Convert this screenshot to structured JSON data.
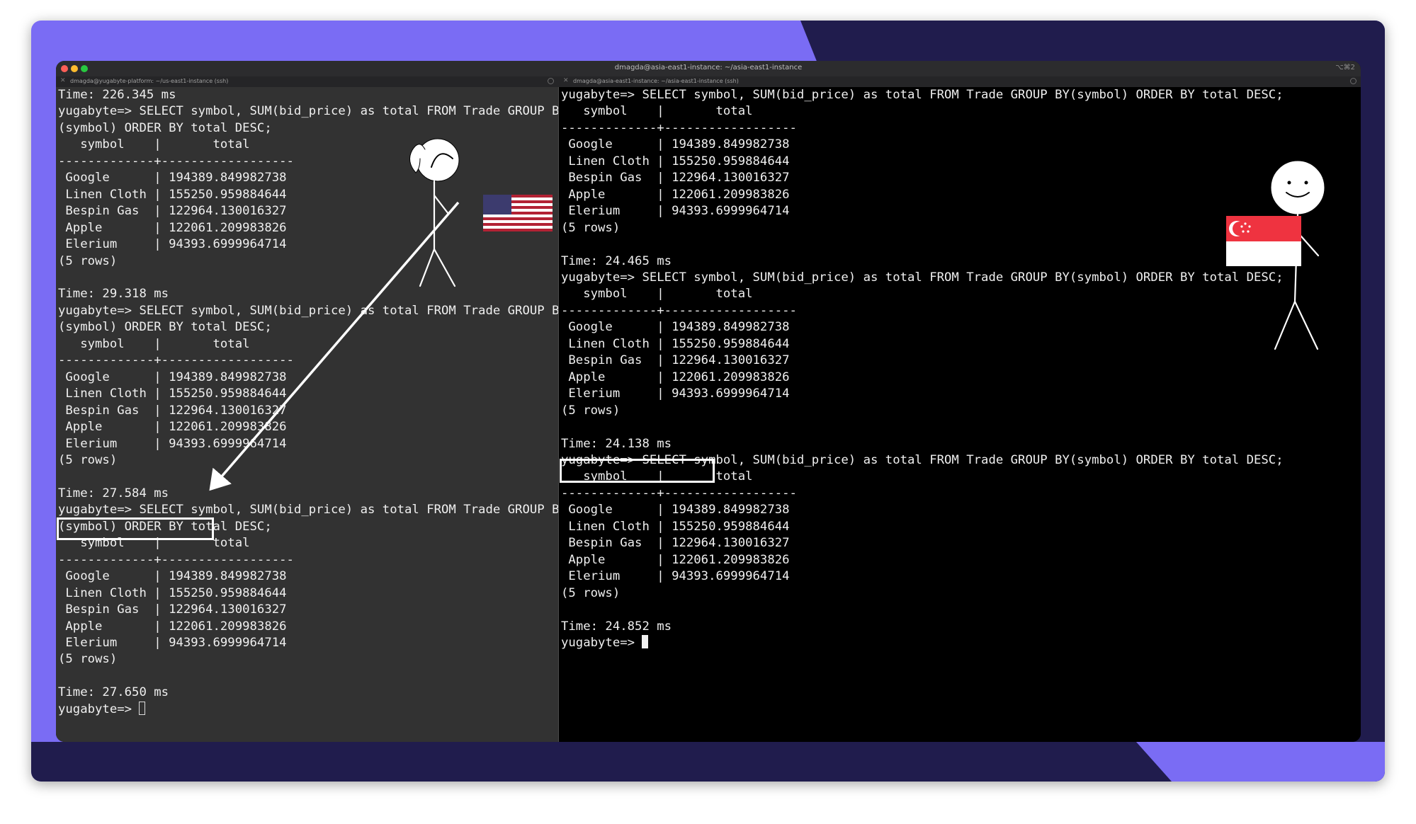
{
  "window": {
    "title": "dmagda@asia-east1-instance: ~/asia-east1-instance",
    "shortcut": "⌥⌘2"
  },
  "tabs": [
    {
      "label": "dmagda@yugabyte-platform: ~/us-east1-instance (ssh)"
    },
    {
      "label": "dmagda@asia-east1-instance: ~/asia-east1-instance (ssh)"
    }
  ],
  "left_terminal": {
    "lines": [
      "Time: 226.345 ms",
      "yugabyte=> SELECT symbol, SUM(bid_price) as total FROM Trade GROUP BY",
      "(symbol) ORDER BY total DESC;",
      "   symbol    |       total",
      "-------------+------------------",
      " Google      | 194389.849982738",
      " Linen Cloth | 155250.959884644",
      " Bespin Gas  | 122964.130016327",
      " Apple       | 122061.209983826",
      " Elerium     | 94393.6999964714",
      "(5 rows)",
      "",
      "Time: 29.318 ms",
      "yugabyte=> SELECT symbol, SUM(bid_price) as total FROM Trade GROUP BY",
      "(symbol) ORDER BY total DESC;",
      "   symbol    |       total",
      "-------------+------------------",
      " Google      | 194389.849982738",
      " Linen Cloth | 155250.959884644",
      " Bespin Gas  | 122964.130016327",
      " Apple       | 122061.209983826",
      " Elerium     | 94393.6999964714",
      "(5 rows)",
      "",
      "Time: 27.584 ms",
      "yugabyte=> SELECT symbol, SUM(bid_price) as total FROM Trade GROUP BY",
      "(symbol) ORDER BY total DESC;",
      "   symbol    |       total",
      "-------------+------------------",
      " Google      | 194389.849982738",
      " Linen Cloth | 155250.959884644",
      " Bespin Gas  | 122964.130016327",
      " Apple       | 122061.209983826",
      " Elerium     | 94393.6999964714",
      "(5 rows)",
      "",
      "Time: 27.650 ms"
    ],
    "prompt": "yugabyte=> "
  },
  "right_terminal": {
    "lines": [
      "yugabyte=> SELECT symbol, SUM(bid_price) as total FROM Trade GROUP BY(symbol) ORDER BY total DESC;",
      "   symbol    |       total",
      "-------------+------------------",
      " Google      | 194389.849982738",
      " Linen Cloth | 155250.959884644",
      " Bespin Gas  | 122964.130016327",
      " Apple       | 122061.209983826",
      " Elerium     | 94393.6999964714",
      "(5 rows)",
      "",
      "Time: 24.465 ms",
      "yugabyte=> SELECT symbol, SUM(bid_price) as total FROM Trade GROUP BY(symbol) ORDER BY total DESC;",
      "   symbol    |       total",
      "-------------+------------------",
      " Google      | 194389.849982738",
      " Linen Cloth | 155250.959884644",
      " Bespin Gas  | 122964.130016327",
      " Apple       | 122061.209983826",
      " Elerium     | 94393.6999964714",
      "(5 rows)",
      "",
      "Time: 24.138 ms",
      "yugabyte=> SELECT symbol, SUM(bid_price) as total FROM Trade GROUP BY(symbol) ORDER BY total DESC;",
      "   symbol    |       total",
      "-------------+------------------",
      " Google      | 194389.849982738",
      " Linen Cloth | 155250.959884644",
      " Bespin Gas  | 122964.130016327",
      " Apple       | 122061.209983826",
      " Elerium     | 94393.6999964714",
      "(5 rows)",
      "",
      "Time: 24.852 ms"
    ],
    "prompt": "yugabyte=> "
  },
  "colors": {
    "card_bg": "#7a6cf4",
    "card_dark": "#201c4d",
    "left_pane_bg": "#323232",
    "right_pane_bg": "#000000",
    "highlight": "#ffffff"
  },
  "icons": {
    "us_flag": "us-flag-icon",
    "sg_flag": "singapore-flag-icon",
    "stick_figure_left": "stick-figure-ponytail",
    "stick_figure_right": "stick-figure-smiling"
  }
}
